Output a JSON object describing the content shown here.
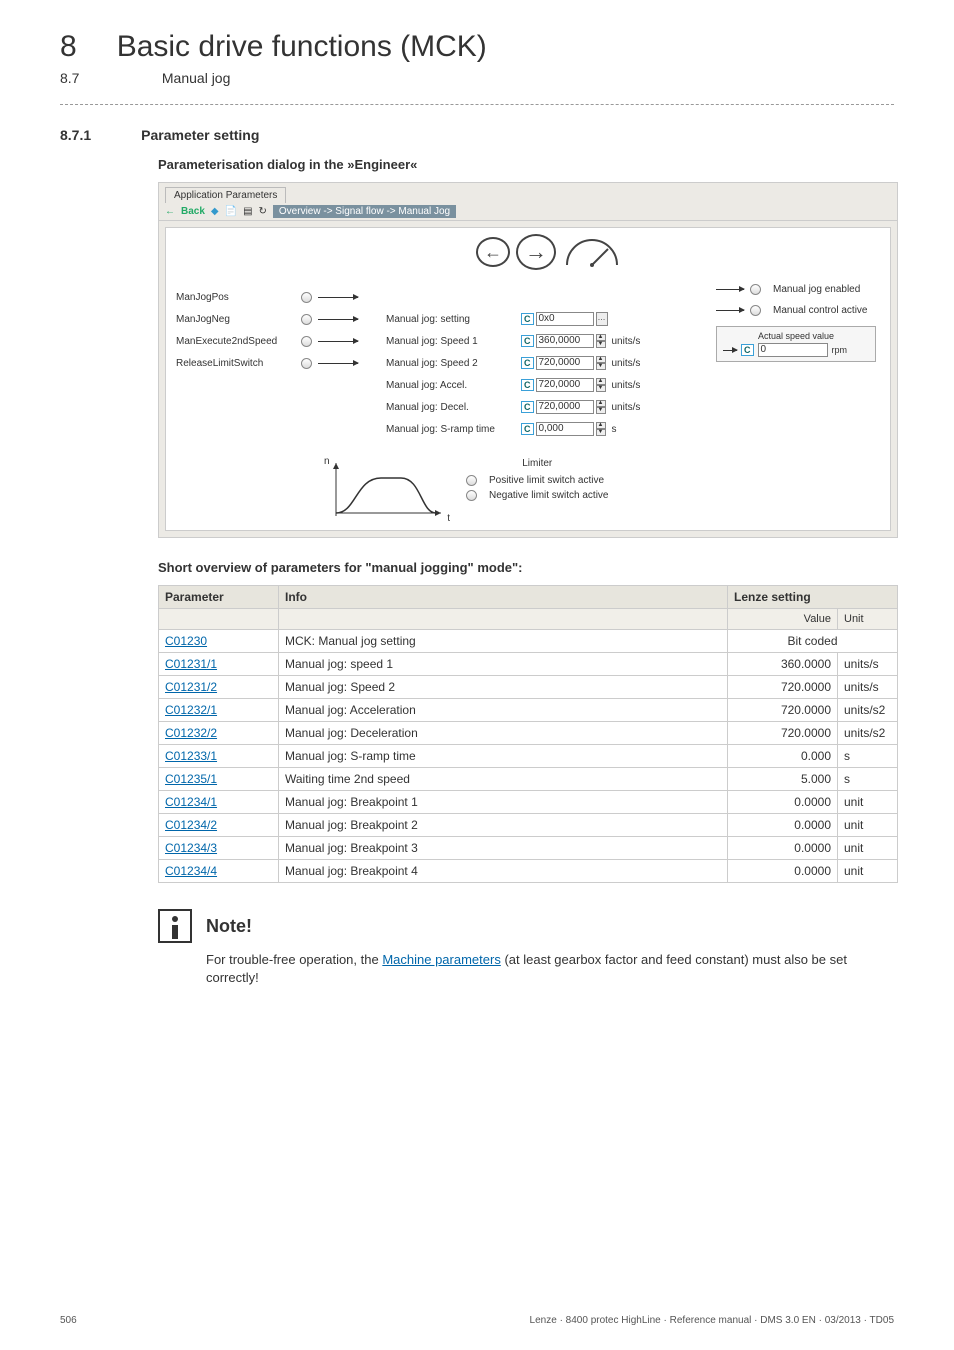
{
  "chapter": {
    "num": "8",
    "title": "Basic drive functions (MCK)"
  },
  "subsection": {
    "num": "8.7",
    "title": "Manual jog"
  },
  "section": {
    "num": "8.7.1",
    "title": "Parameter setting"
  },
  "dialog_heading": "Parameterisation dialog in the »Engineer«",
  "engineer": {
    "tab": "Application Parameters",
    "back": "Back",
    "breadcrumb": "Overview -> Signal flow -> Manual Jog",
    "signals": [
      "ManJogPos",
      "ManJogNeg",
      "ManExecute2ndSpeed",
      "ReleaseLimitSwitch"
    ],
    "params": [
      {
        "label": "Manual jog: setting",
        "value": "0x0",
        "unit": "-",
        "btn": true
      },
      {
        "label": "Manual jog: Speed 1",
        "value": "360,0000",
        "unit": "units/s"
      },
      {
        "label": "Manual jog: Speed 2",
        "value": "720,0000",
        "unit": "units/s"
      },
      {
        "label": "Manual jog: Accel.",
        "value": "720,0000",
        "unit": "units/s"
      },
      {
        "label": "Manual jog: Decel.",
        "value": "720,0000",
        "unit": "units/s"
      },
      {
        "label": "Manual jog: S-ramp time",
        "value": "0,000",
        "unit": "s"
      }
    ],
    "outputs": {
      "enabled": "Manual jog enabled",
      "control": "Manual control active",
      "actual_label": "Actual speed value",
      "actual_value": "0",
      "actual_unit": "rpm"
    },
    "limiter": {
      "title": "Limiter",
      "pos": "Positive limit switch active",
      "neg": "Negative limit switch active",
      "n_axis": "n",
      "t_axis": "t"
    }
  },
  "table_heading": "Short overview of parameters for \"manual jogging\" mode\":",
  "table": {
    "head": {
      "param": "Parameter",
      "info": "Info",
      "lenze": "Lenze setting",
      "value": "Value",
      "unit": "Unit"
    },
    "rows": [
      {
        "param": "C01230",
        "info": "MCK: Manual jog setting",
        "value": "Bit coded",
        "unit": "",
        "span": true
      },
      {
        "param": "C01231/1",
        "info": "Manual jog: speed 1",
        "value": "360.0000",
        "unit": "units/s"
      },
      {
        "param": "C01231/2",
        "info": "Manual jog: Speed 2",
        "value": "720.0000",
        "unit": "units/s"
      },
      {
        "param": "C01232/1",
        "info": "Manual jog: Acceleration",
        "value": "720.0000",
        "unit": "units/s2"
      },
      {
        "param": "C01232/2",
        "info": "Manual jog: Deceleration",
        "value": "720.0000",
        "unit": "units/s2"
      },
      {
        "param": "C01233/1",
        "info": "Manual jog: S-ramp time",
        "value": "0.000",
        "unit": "s"
      },
      {
        "param": "C01235/1",
        "info": "Waiting time 2nd speed",
        "value": "5.000",
        "unit": "s"
      },
      {
        "param": "C01234/1",
        "info": "Manual jog: Breakpoint 1",
        "value": "0.0000",
        "unit": "unit"
      },
      {
        "param": "C01234/2",
        "info": "Manual jog: Breakpoint 2",
        "value": "0.0000",
        "unit": "unit"
      },
      {
        "param": "C01234/3",
        "info": "Manual jog: Breakpoint 3",
        "value": "0.0000",
        "unit": "unit"
      },
      {
        "param": "C01234/4",
        "info": "Manual jog: Breakpoint 4",
        "value": "0.0000",
        "unit": "unit"
      }
    ]
  },
  "note": {
    "label": "Note!",
    "text_before": "For trouble-free operation, the ",
    "link": "Machine parameters",
    "text_after": " (at least gearbox factor and feed constant) must also be set correctly!"
  },
  "footer": {
    "page": "506",
    "info": "Lenze · 8400 protec HighLine · Reference manual · DMS 3.0 EN · 03/2013 · TD05"
  }
}
